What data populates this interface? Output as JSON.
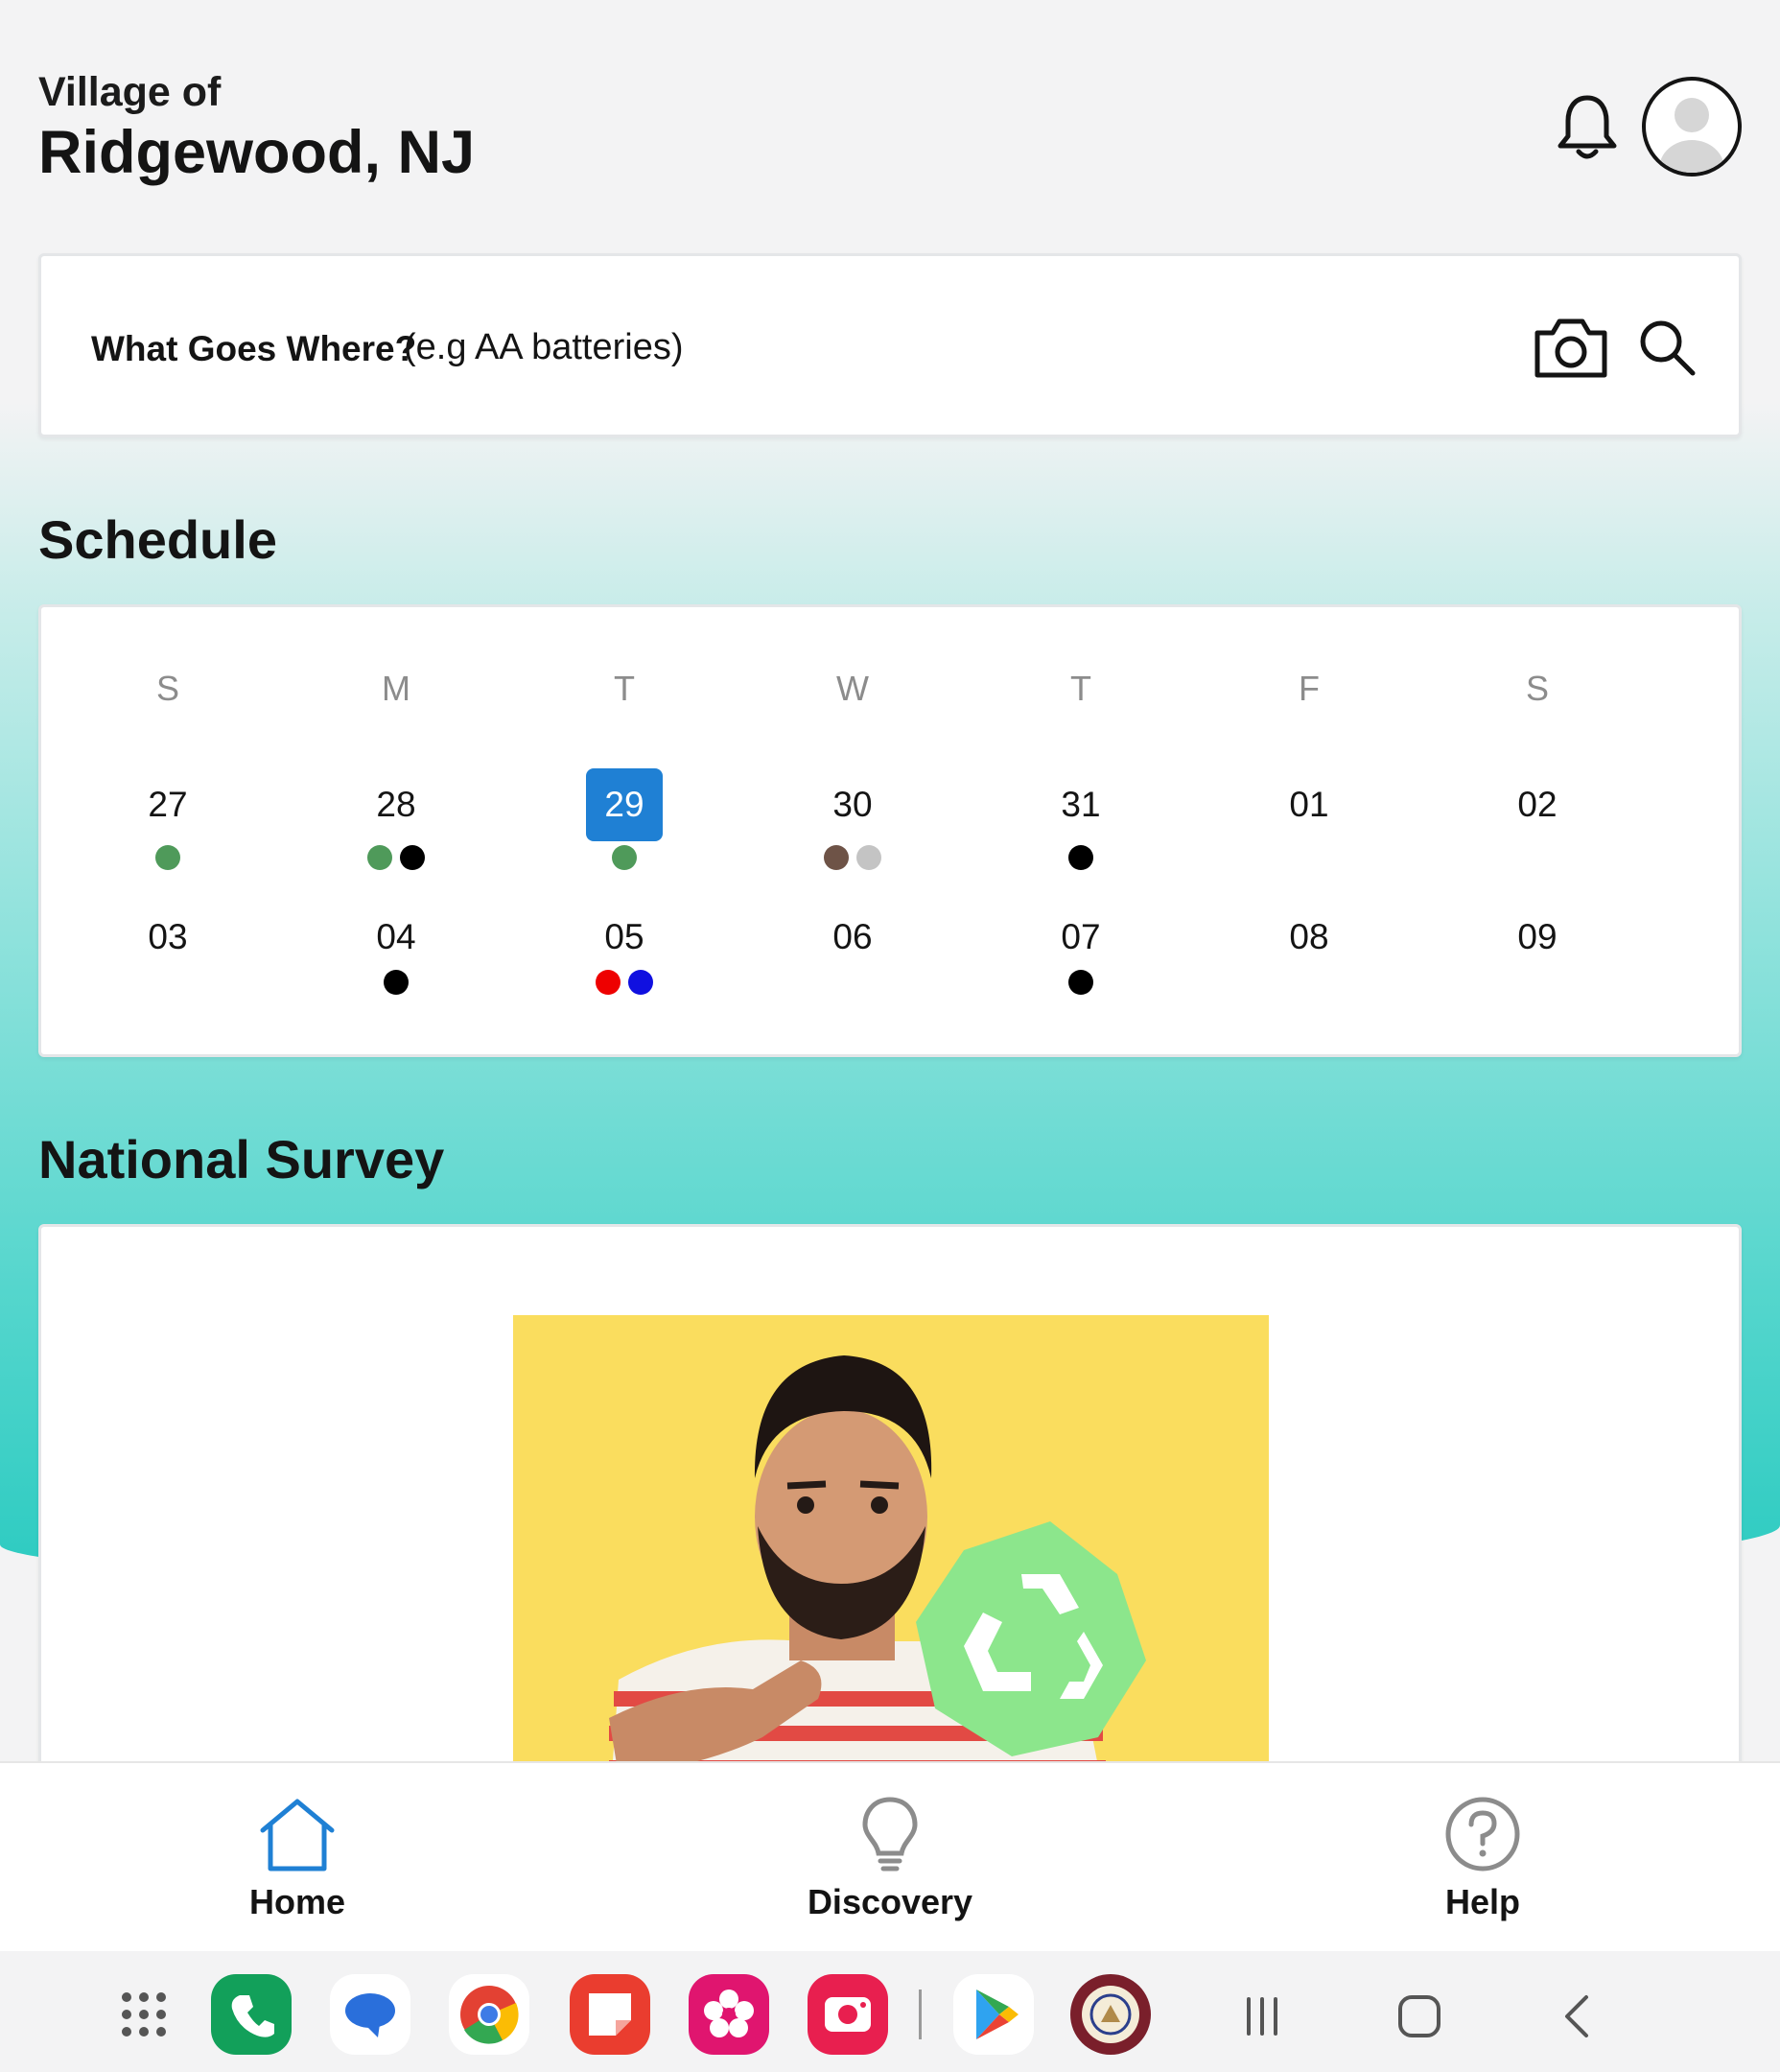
{
  "header": {
    "village_of": "Village of",
    "city": "Ridgewood, NJ"
  },
  "search": {
    "label": "What Goes Where?",
    "hint": "(e.g AA batteries)"
  },
  "schedule": {
    "title": "Schedule",
    "weekdays": [
      "S",
      "M",
      "T",
      "W",
      "T",
      "F",
      "S"
    ],
    "week1": [
      {
        "day": "27",
        "dots": [
          "#4f9a5a"
        ]
      },
      {
        "day": "28",
        "dots": [
          "#4f9a5a",
          "#000000"
        ]
      },
      {
        "day": "29",
        "dots": [
          "#4f9a5a"
        ],
        "today": true
      },
      {
        "day": "30",
        "dots": [
          "#6e5347",
          "#c4c4c4"
        ]
      },
      {
        "day": "31",
        "dots": [
          "#000000"
        ]
      },
      {
        "day": "01",
        "dots": []
      },
      {
        "day": "02",
        "dots": []
      }
    ],
    "week2": [
      {
        "day": "03",
        "dots": []
      },
      {
        "day": "04",
        "dots": [
          "#000000"
        ]
      },
      {
        "day": "05",
        "dots": [
          "#ee0000",
          "#1010e0"
        ]
      },
      {
        "day": "06",
        "dots": []
      },
      {
        "day": "07",
        "dots": [
          "#000000"
        ]
      },
      {
        "day": "08",
        "dots": []
      },
      {
        "day": "09",
        "dots": []
      }
    ],
    "today_color": "#1f80d4"
  },
  "survey": {
    "title": "National Survey",
    "image": "man-pointing-with-recycle-sign"
  },
  "nav": {
    "home": "Home",
    "discovery": "Discovery",
    "help": "Help",
    "active_color": "#1f80d4"
  },
  "system_bar": {
    "apps": [
      "apps-grid-icon",
      "phone-app-icon",
      "messages-app-icon",
      "chrome-app-icon",
      "notes-app-icon",
      "blossom-app-icon",
      "camera-app-icon",
      "play-store-app-icon",
      "ridgewood-app-icon"
    ],
    "buttons": [
      "recents-button",
      "home-button",
      "back-button"
    ]
  }
}
